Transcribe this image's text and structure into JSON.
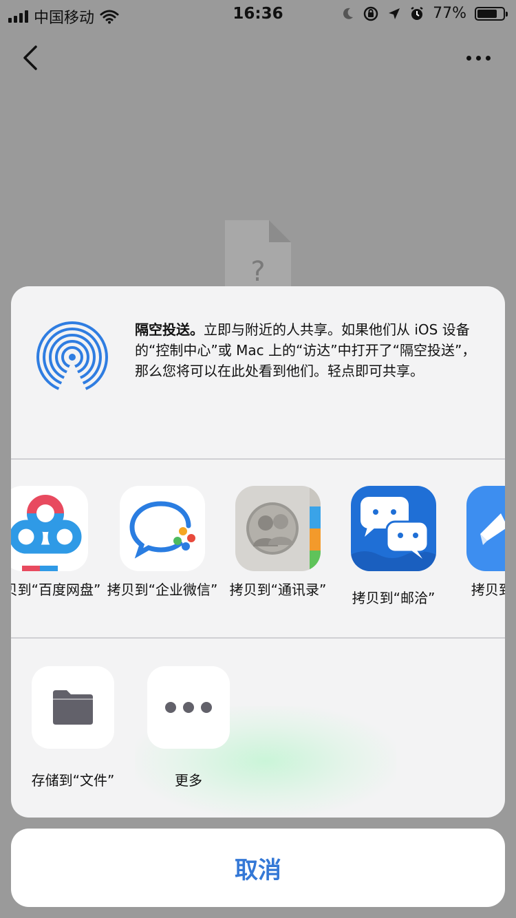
{
  "status_bar": {
    "carrier": "中国移动",
    "time": "16:36",
    "battery": "77%",
    "battery_level": 0.77
  },
  "page": {
    "file_placeholder_icon": "unknown-file-icon"
  },
  "share_sheet": {
    "airdrop": {
      "title": "隔空投送。",
      "description": "立即与附近的人共享。如果他们从 iOS 设备的“控制中心”或 Mac 上的“访达”中打开了“隔空投送”，那么您将可以在此处看到他们。轻点即可共享。",
      "icon": "airdrop-icon"
    },
    "apps": [
      {
        "label": "拷贝到“百度网盘”",
        "icon": "baidu-netdisk-icon"
      },
      {
        "label": "拷贝到“企业微信”",
        "icon": "wecom-icon"
      },
      {
        "label": "拷贝到“通讯录”",
        "icon": "contacts-icon"
      },
      {
        "label": "拷贝到“邮洽”",
        "icon": "youqia-icon"
      },
      {
        "label": "拷贝到“云笔",
        "icon": "cloud-note-icon"
      }
    ],
    "actions": [
      {
        "label": "存储到“文件”",
        "icon": "folder-icon"
      },
      {
        "label": "更多",
        "icon": "more-icon"
      }
    ],
    "cancel_label": "取消"
  },
  "colors": {
    "accent": "#3478d6",
    "airdrop_blue": "#2f7de1",
    "youqia_blue": "#1f6fd6"
  }
}
